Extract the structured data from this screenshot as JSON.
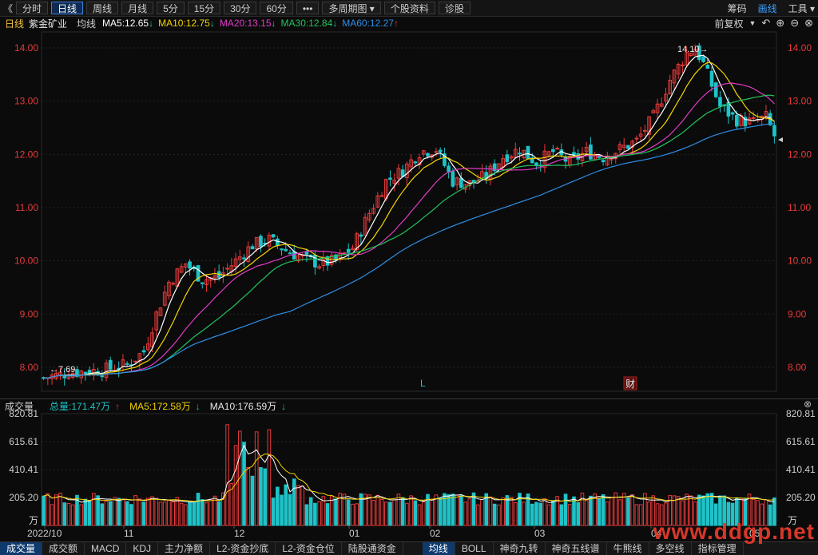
{
  "toolbar": {
    "back": "《",
    "tabs": [
      "分时",
      "日线",
      "周线",
      "月线",
      "5分",
      "15分",
      "30分",
      "60分",
      "•••",
      "多周期图 ▾",
      "个股资料",
      "诊股"
    ],
    "active_tab": 1,
    "right": [
      "筹码",
      "画线",
      "工具 ▾"
    ],
    "right_active": 1
  },
  "info": {
    "period": "日线",
    "stock": "紫金矿业",
    "ma_label": "均线",
    "ma5": "MA5:12.65",
    "ma5_dir": "↓",
    "ma10": "MA10:12.75",
    "ma10_dir": "↓",
    "ma20": "MA20:13.15",
    "ma20_dir": "↓",
    "ma30": "MA30:12.84",
    "ma30_dir": "↓",
    "ma60": "MA60:12.27",
    "ma60_dir": "↑",
    "adjust": "前复权"
  },
  "colors": {
    "up": "#e8393a",
    "down": "#1ec3c8",
    "ma5": "#ffffff",
    "ma10": "#f5d400",
    "ma20": "#e23bc6",
    "ma30": "#22c35d",
    "ma60": "#2e8ee6",
    "axis": "#e8393a"
  },
  "vol_info": {
    "label": "成交量",
    "total": "总量:171.47万",
    "total_dir": "↑",
    "ma5": "MA5:172.58万",
    "ma5_dir": "↓",
    "ma10": "MA10:176.59万",
    "ma10_dir": "↓",
    "close_icon": "⊗"
  },
  "markers": {
    "l": "L",
    "cai": "财",
    "high": "14.10",
    "low": "7.69"
  },
  "chart_data": {
    "type": "candlestick",
    "price_axis": [
      "14.00",
      "13.00",
      "12.00",
      "11.00",
      "10.00",
      "9.00",
      "8.00"
    ],
    "price_range": [
      7.55,
      14.3
    ],
    "vol_axis": [
      "820.81",
      "615.61",
      "410.41",
      "205.20"
    ],
    "vol_unit": "万",
    "vol_range": [
      0,
      820.81
    ],
    "x_labels": [
      "2022/10",
      "11",
      "12",
      "01",
      "02",
      "03",
      "04",
      "05"
    ],
    "price_high": 14.1,
    "price_low": 7.69,
    "ma_final": {
      "ma5": 12.65,
      "ma10": 12.75,
      "ma20": 13.15,
      "ma30": 12.84,
      "ma60": 12.27
    },
    "vol_final": {
      "total": 171.47,
      "ma5": 172.58,
      "ma10": 176.59
    }
  },
  "bottombar": {
    "tabs": [
      "成交量",
      "成交额",
      "MACD",
      "KDJ",
      "主力净额",
      "L2-资金抄底",
      "L2-资金仓位",
      "陆股通资金"
    ],
    "active": 0,
    "tabs2": [
      "均线",
      "BOLL",
      "神奇九转",
      "神奇五线谱",
      "牛熊线",
      "多空线",
      "指标管理"
    ],
    "active2": 0
  },
  "watermark": "www.ddgp.net"
}
